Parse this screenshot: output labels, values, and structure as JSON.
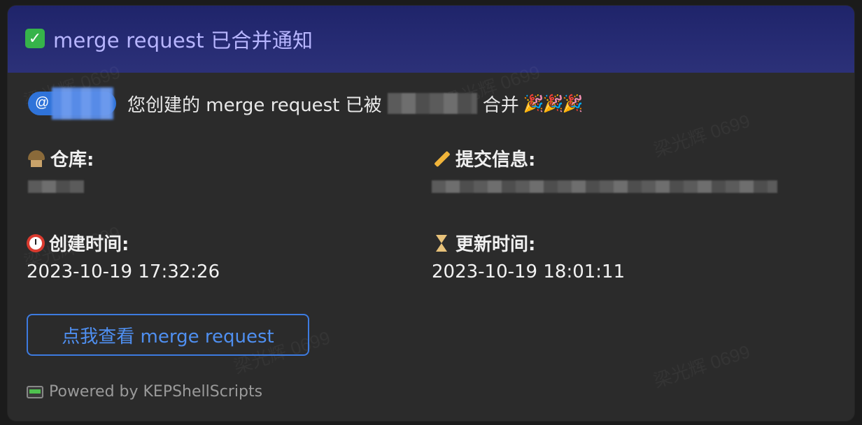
{
  "header": {
    "title": "merge request 已合并通知",
    "icon": "check-mark-icon"
  },
  "intro": {
    "mention_prefix": "@",
    "text_before": "您创建的 merge request 已被",
    "text_after": "合并",
    "celebration": "🎉🎉🎉"
  },
  "fields": {
    "repository_label": "仓库:",
    "commit_message_label": "提交信息:",
    "created_time_label": "创建时间:",
    "created_time_value": "2023-10-19 17:32:26",
    "updated_time_label": "更新时间:",
    "updated_time_value": "2023-10-19 18:01:11"
  },
  "button": {
    "label": "点我查看 merge request"
  },
  "footer": {
    "text": "Powered by KEPShellScripts"
  },
  "watermark": {
    "text": "梁光辉 0699"
  },
  "colors": {
    "header_bg": "#232870",
    "header_text": "#b8b6ff",
    "card_bg": "#2b2b2b",
    "accent_blue": "#3d7be0",
    "check_green": "#36b34a"
  }
}
